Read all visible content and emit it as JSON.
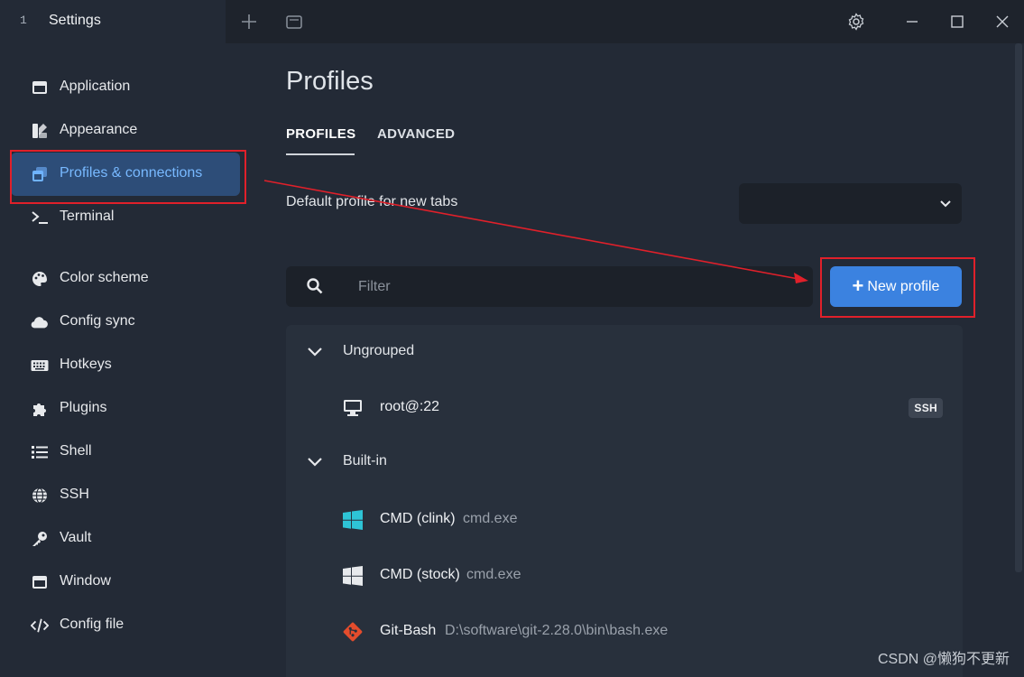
{
  "titlebar": {
    "tab_index": "1",
    "tab_title": "Settings",
    "icons": [
      "plus-icon",
      "window-icon",
      "gear-icon",
      "minimize-icon",
      "maximize-icon",
      "close-icon"
    ]
  },
  "sidebar": {
    "items": [
      {
        "label": "Application",
        "icon": "application-icon"
      },
      {
        "label": "Appearance",
        "icon": "appearance-icon"
      },
      {
        "label": "Profiles & connections",
        "icon": "profiles-icon",
        "active": true
      },
      {
        "label": "Terminal",
        "icon": "terminal-icon"
      },
      {
        "label": "Color scheme",
        "icon": "palette-icon"
      },
      {
        "label": "Config sync",
        "icon": "cloud-icon"
      },
      {
        "label": "Hotkeys",
        "icon": "keyboard-icon"
      },
      {
        "label": "Plugins",
        "icon": "puzzle-icon"
      },
      {
        "label": "Shell",
        "icon": "list-icon"
      },
      {
        "label": "SSH",
        "icon": "globe-icon"
      },
      {
        "label": "Vault",
        "icon": "key-icon"
      },
      {
        "label": "Window",
        "icon": "window-icon"
      },
      {
        "label": "Config file",
        "icon": "code-icon"
      }
    ]
  },
  "main": {
    "title": "Profiles",
    "tabs": [
      {
        "label": "PROFILES",
        "active": true
      },
      {
        "label": "ADVANCED",
        "active": false
      }
    ],
    "default_profile_label": "Default profile for new tabs",
    "default_profile_value": "",
    "filter_placeholder": "Filter",
    "new_profile_label": "New profile",
    "groups": [
      {
        "label": "Ungrouped",
        "profiles": [
          {
            "name": "root@:22",
            "command": "",
            "badge": "SSH",
            "icon": "monitor-icon"
          }
        ]
      },
      {
        "label": "Built-in",
        "profiles": [
          {
            "name": "CMD (clink)",
            "command": "cmd.exe",
            "icon": "windows-logo-icon"
          },
          {
            "name": "CMD (stock)",
            "command": "cmd.exe",
            "icon": "windows-logo-icon"
          },
          {
            "name": "Git-Bash",
            "command": "D:\\software\\git-2.28.0\\bin\\bash.exe",
            "icon": "git-icon"
          }
        ]
      }
    ]
  },
  "watermark": "CSDN @懒狗不更新",
  "colors": {
    "accent": "#3b82e0",
    "active_nav_bg": "#2d4d78",
    "annotation": "#e0202a"
  }
}
